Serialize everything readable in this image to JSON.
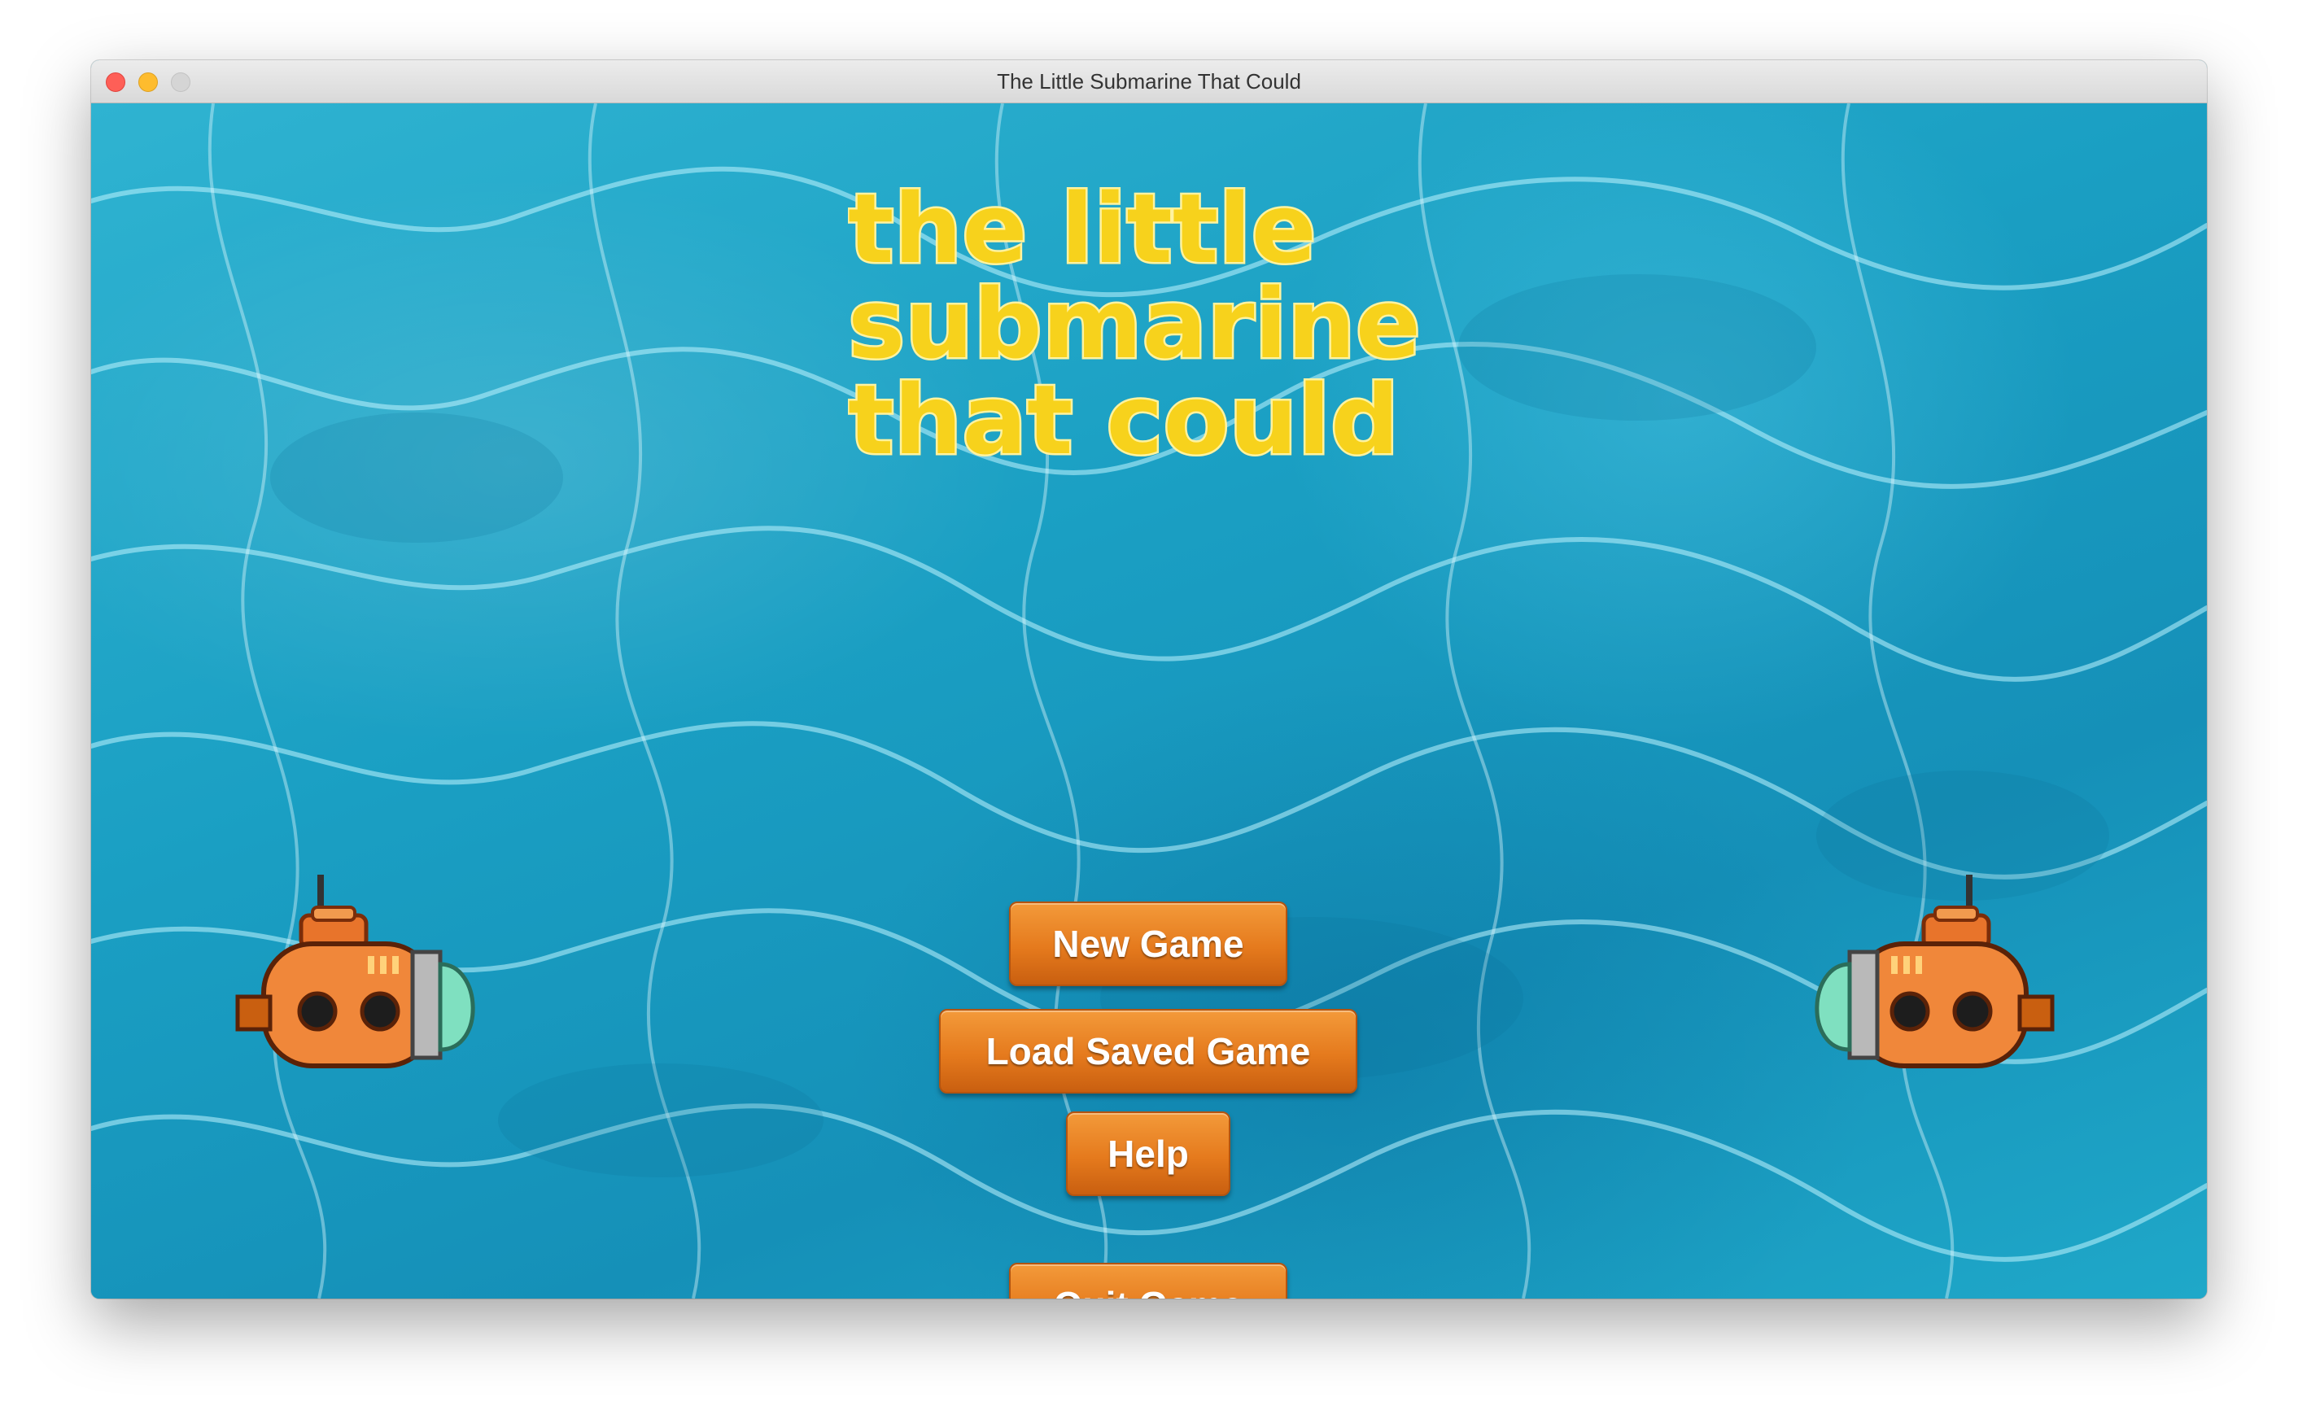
{
  "window": {
    "title": "The Little Submarine That Could"
  },
  "logo": {
    "lines": [
      "the little",
      "submarine",
      "that could"
    ],
    "fill_color": "#f7d21c",
    "outline_color": "#fff3a0"
  },
  "menu": {
    "new_game": "New Game",
    "load_saved_game": "Load Saved Game",
    "help": "Help",
    "quit_game": "Quit Game"
  },
  "colors": {
    "water": "#1aa3c4",
    "button": "#e57a1d",
    "submarine_body": "#f0873a",
    "submarine_window": "#7fe0c0"
  },
  "icons": {
    "left_sprite": "submarine-icon",
    "right_sprite": "submarine-icon"
  }
}
